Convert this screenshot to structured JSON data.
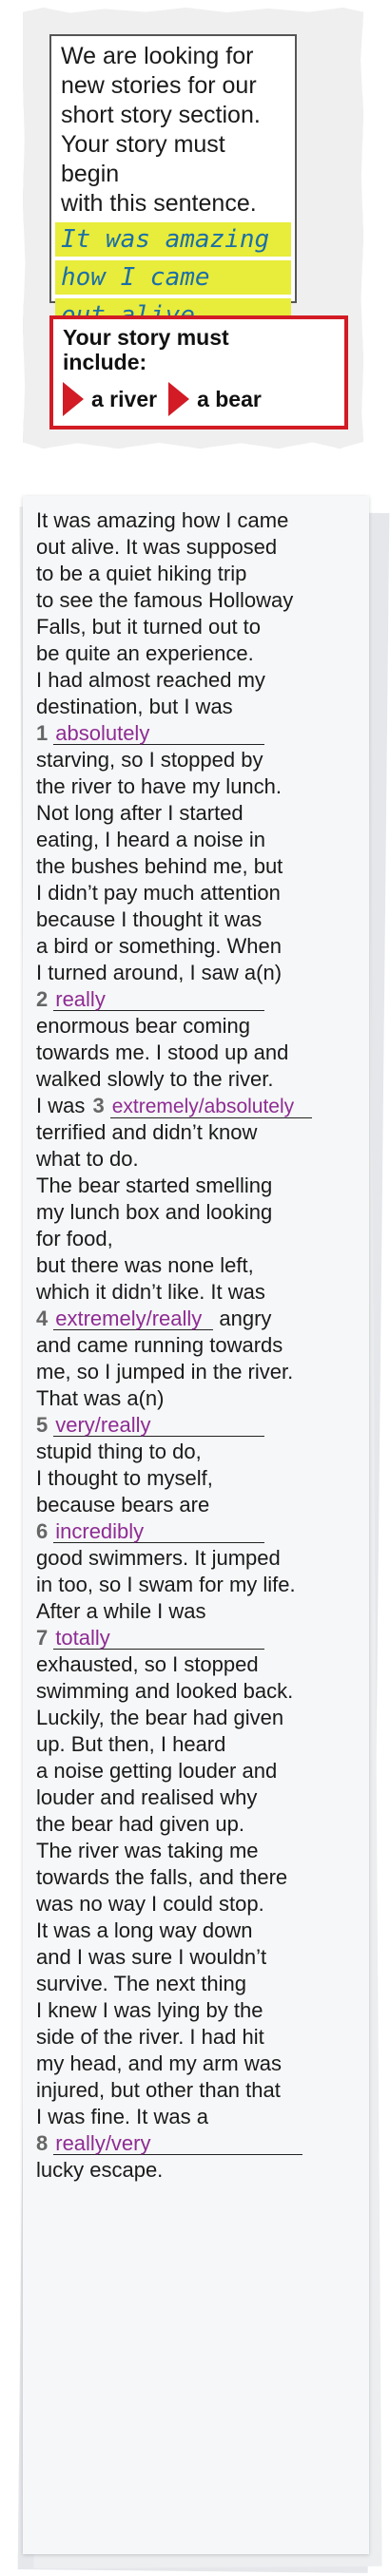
{
  "notice": {
    "intro_lines": [
      "We are looking for",
      "new stories for our",
      "short story section.",
      "Your story must begin",
      "with this sentence."
    ],
    "sentence_lines": [
      "It was amazing",
      "how I came",
      "out alive."
    ],
    "include_title_lines": [
      "Your story must",
      "include:"
    ],
    "include_items": [
      "a river",
      "a bear"
    ],
    "colors": {
      "highlight": "#e8ec3a",
      "sentence_text": "#1b6fa8",
      "frame_red": "#d21b25"
    }
  },
  "story": {
    "lines": [
      "It was amazing how I came",
      "out alive. It was supposed",
      "to be a quiet hiking trip",
      "to see the famous Holloway",
      "Falls, but it turned out to",
      "be quite an experience.",
      "I had almost reached my",
      "destination, but I was",
      "starving, so I stopped by",
      "the river to have my lunch.",
      "Not long after I started",
      "eating, I heard a noise in",
      "the bushes behind me, but",
      "I didn’t pay much attention",
      "because I thought it was",
      "a bird or something. When",
      "I turned around, I saw a(n)",
      "enormous bear coming",
      "towards me. I stood up and",
      "walked slowly to the river.",
      "I was",
      "terrified and didn’t know",
      "what to do.",
      "The bear started smelling",
      "my lunch box and looking",
      "for food,",
      "but there was none left,",
      "which it didn’t like. It was",
      "angry",
      "and came running towards",
      "me, so I jumped in the river.",
      "That was a(n)",
      "stupid thing to do,",
      "I thought to myself,",
      "because bears are",
      "good swimmers. It jumped",
      "in too, so I swam for my life.",
      "After a while I was",
      "exhausted, so I stopped",
      "swimming and looked back.",
      "Luckily, the bear had given",
      "up. But then, I heard",
      "a noise getting louder and",
      "louder and realised why",
      "the bear had given up.",
      "The river was taking me",
      "towards the falls, and there",
      "was no way I could stop.",
      "It was a long way down",
      "and I was sure I wouldn’t",
      "survive. The next thing",
      "I knew I was lying by the",
      "side of the river. I had hit",
      "my head, and my arm was",
      "injured, but other than that",
      "I was fine. It was a",
      "lucky escape."
    ],
    "gaps": [
      {
        "number": "1",
        "answer": "absolutely"
      },
      {
        "number": "2",
        "answer": "really"
      },
      {
        "number": "3",
        "answer": "extremely/absolutely"
      },
      {
        "number": "4",
        "answer": "extremely/really"
      },
      {
        "number": "5",
        "answer": "very/really"
      },
      {
        "number": "6",
        "answer": "incredibly"
      },
      {
        "number": "7",
        "answer": "totally"
      },
      {
        "number": "8",
        "answer": "really/very"
      }
    ],
    "colors": {
      "answer_text": "#8e2c93",
      "paper": "#f6f7f8"
    }
  }
}
